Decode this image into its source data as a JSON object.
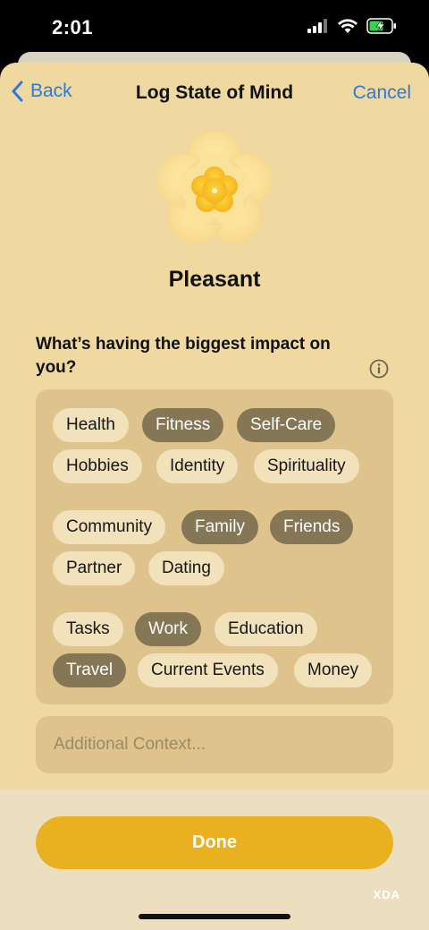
{
  "status_bar": {
    "time": "2:01"
  },
  "nav": {
    "back_label": "Back",
    "title": "Log State of Mind",
    "cancel_label": "Cancel"
  },
  "mood": {
    "label": "Pleasant"
  },
  "question": {
    "text": "What’s having the biggest impact on you?"
  },
  "chips": [
    {
      "label": "Health",
      "selected": false
    },
    {
      "label": "Fitness",
      "selected": true
    },
    {
      "label": "Self-Care",
      "selected": true
    },
    {
      "label": "Hobbies",
      "selected": false
    },
    {
      "label": "Identity",
      "selected": false
    },
    {
      "label": "Spirituality",
      "selected": false
    },
    {
      "label": "Community",
      "selected": false
    },
    {
      "label": "Family",
      "selected": true
    },
    {
      "label": "Friends",
      "selected": true
    },
    {
      "label": "Partner",
      "selected": false
    },
    {
      "label": "Dating",
      "selected": false
    },
    {
      "label": "Tasks",
      "selected": false
    },
    {
      "label": "Work",
      "selected": true
    },
    {
      "label": "Education",
      "selected": false
    },
    {
      "label": "Travel",
      "selected": true
    },
    {
      "label": "Current Events",
      "selected": false
    },
    {
      "label": "Money",
      "selected": false
    }
  ],
  "context": {
    "placeholder": "Additional Context...",
    "value": ""
  },
  "done": {
    "label": "Done"
  },
  "watermark": "XDA",
  "colors": {
    "accent": "#2a7bd9",
    "done": "#e9b01f",
    "chip_selected": "#857656",
    "chip_unselected": "#f1e2bb",
    "sheet": "#efd9a1"
  }
}
